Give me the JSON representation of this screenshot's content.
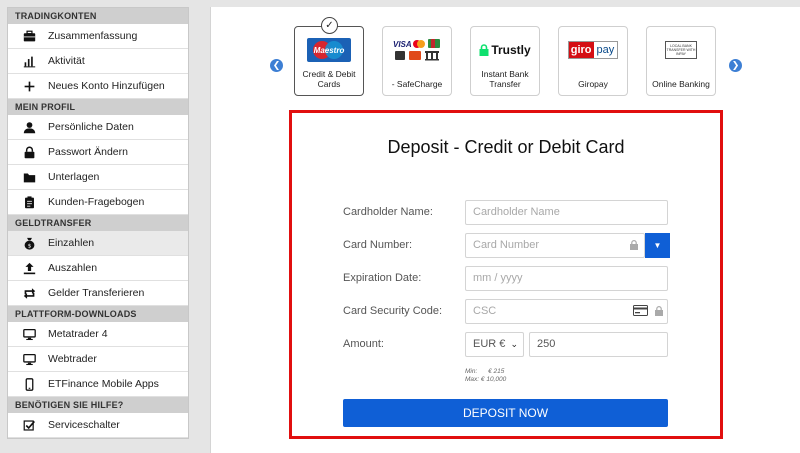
{
  "sidebar": {
    "sections": [
      {
        "header": "Tradingkonten",
        "items": [
          {
            "label": "Zusammenfassung",
            "icon": "briefcase-icon"
          },
          {
            "label": "Aktivität",
            "icon": "bar-chart-icon"
          },
          {
            "label": "Neues Konto Hinzufügen",
            "icon": "plus-icon"
          }
        ]
      },
      {
        "header": "Mein Profil",
        "items": [
          {
            "label": "Persönliche Daten",
            "icon": "user-icon"
          },
          {
            "label": "Passwort Ändern",
            "icon": "lock-icon"
          },
          {
            "label": "Unterlagen",
            "icon": "folder-icon"
          },
          {
            "label": "Kunden-Fragebogen",
            "icon": "clipboard-icon"
          }
        ]
      },
      {
        "header": "Geldtransfer",
        "items": [
          {
            "label": "Einzahlen",
            "icon": "money-bag-icon",
            "active": true
          },
          {
            "label": "Auszahlen",
            "icon": "upload-icon"
          },
          {
            "label": "Gelder Transferieren",
            "icon": "transfer-icon"
          }
        ]
      },
      {
        "header": "Plattform-Downloads",
        "items": [
          {
            "label": "Metatrader 4",
            "icon": "monitor-icon"
          },
          {
            "label": "Webtrader",
            "icon": "monitor-icon"
          },
          {
            "label": "ETFinance Mobile Apps",
            "icon": "smartphone-icon"
          }
        ]
      },
      {
        "header": "Benötigen Sie Hilfe?",
        "items": [
          {
            "label": "Serviceschalter",
            "icon": "checkbox-icon"
          }
        ]
      }
    ]
  },
  "payment_methods": [
    {
      "label": "Credit & Debit Cards",
      "logo_text": "Maestro",
      "selected": true
    },
    {
      "label": "- SafeCharge",
      "logo_text": "VISA"
    },
    {
      "label": "Instant Bank Transfer",
      "logo_text": "Trustly"
    },
    {
      "label": "Giropay",
      "logo_text": "giropay"
    },
    {
      "label": "Online Banking",
      "logo_text": "LOCAL BANK TRANSFER WITH INPAY"
    }
  ],
  "form": {
    "title": "Deposit - Credit or Debit Card",
    "cardholder_label": "Cardholder Name:",
    "cardholder_placeholder": "Cardholder Name",
    "card_number_label": "Card Number:",
    "card_number_placeholder": "Card Number",
    "expiration_label": "Expiration Date:",
    "expiration_placeholder": "mm / yyyy",
    "csc_label": "Card Security Code:",
    "csc_placeholder": "CSC",
    "amount_label": "Amount:",
    "currency": "EUR €",
    "amount_value": "250",
    "min_label": "Min:",
    "min_value": "€ 215",
    "max_label": "Max:",
    "max_value": "€ 10,000",
    "submit_label": "DEPOSIT NOW"
  },
  "colors": {
    "accent": "#0f5fd6",
    "highlight_border": "#e10f0f",
    "nav_arrow": "#3d7fd4"
  }
}
